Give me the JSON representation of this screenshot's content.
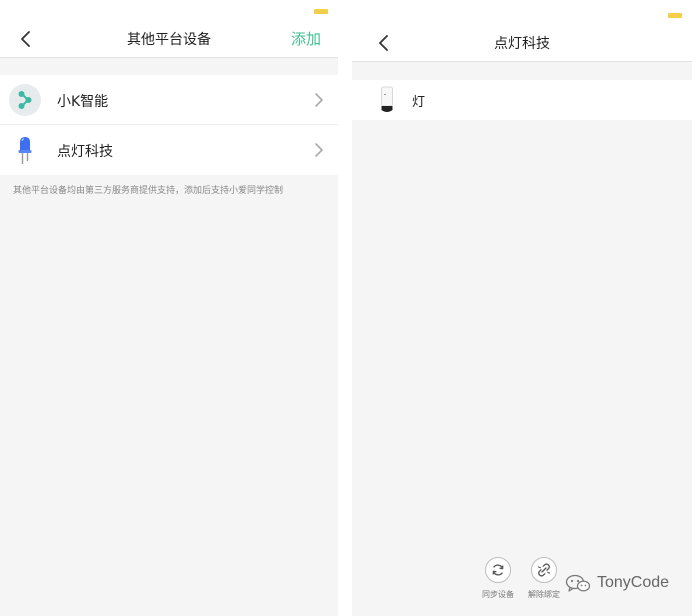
{
  "colors": {
    "accent_green": "#3fbf8f",
    "battery_yellow": "#f3cf4a",
    "background": "#f5f5f5"
  },
  "left_screen": {
    "header": {
      "title": "其他平台设备",
      "add_label": "添加"
    },
    "platforms": [
      {
        "label": "小K智能",
        "icon": "share-nodes-icon"
      },
      {
        "label": "点灯科技",
        "icon": "led-bulb-icon"
      }
    ],
    "footnote": "其他平台设备均由第三方服务商提供支持，添加后支持小爱同学控制"
  },
  "right_screen": {
    "header": {
      "title": "点灯科技"
    },
    "devices": [
      {
        "label": "灯",
        "icon": "smart-lamp-icon"
      }
    ],
    "actions": {
      "sync_label": "同步设备",
      "unbind_label": "解除绑定"
    }
  },
  "watermark": {
    "text": "TonyCode"
  }
}
